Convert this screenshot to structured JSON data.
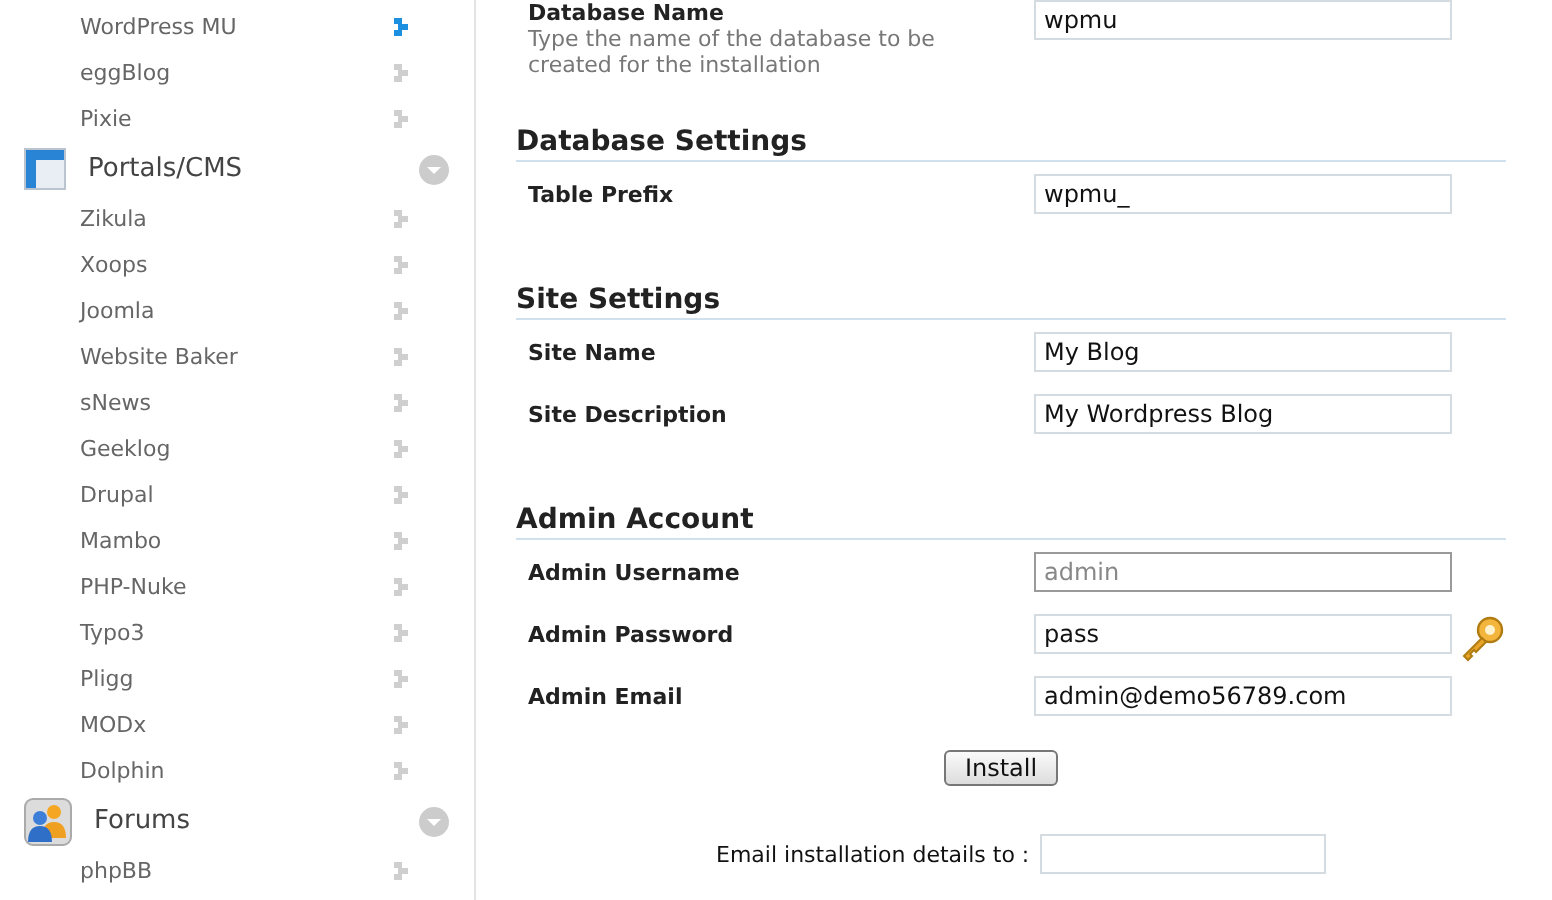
{
  "sidebar": {
    "groups": [
      {
        "items": [
          {
            "label": "WordPress MU",
            "selected": true
          },
          {
            "label": "eggBlog",
            "selected": false
          },
          {
            "label": "Pixie",
            "selected": false
          }
        ]
      },
      {
        "title": "Portals/CMS",
        "kind": "window",
        "expanded": true,
        "items": [
          {
            "label": "Zikula",
            "selected": false
          },
          {
            "label": "Xoops",
            "selected": false
          },
          {
            "label": "Joomla",
            "selected": false
          },
          {
            "label": "Website Baker",
            "selected": false
          },
          {
            "label": "sNews",
            "selected": false
          },
          {
            "label": "Geeklog",
            "selected": false
          },
          {
            "label": "Drupal",
            "selected": false
          },
          {
            "label": "Mambo",
            "selected": false
          },
          {
            "label": "PHP-Nuke",
            "selected": false
          },
          {
            "label": "Typo3",
            "selected": false
          },
          {
            "label": "Pligg",
            "selected": false
          },
          {
            "label": "MODx",
            "selected": false
          },
          {
            "label": "Dolphin",
            "selected": false
          }
        ]
      },
      {
        "title": "Forums",
        "kind": "people",
        "expanded": true,
        "items": [
          {
            "label": "phpBB",
            "selected": false
          }
        ]
      }
    ]
  },
  "form": {
    "sections": [
      {
        "fields": [
          {
            "label": "Database Name",
            "description": "Type the name of the database to be created for the installation",
            "value": "wpmu",
            "kind": "text"
          }
        ]
      },
      {
        "heading": "Database Settings",
        "fields": [
          {
            "label": "Table Prefix",
            "value": "wpmu_",
            "kind": "text"
          }
        ]
      },
      {
        "heading": "Site Settings",
        "fields": [
          {
            "label": "Site Name",
            "value": "My Blog",
            "kind": "text"
          },
          {
            "label": "Site Description",
            "value": "My Wordpress Blog",
            "kind": "text"
          }
        ]
      },
      {
        "heading": "Admin Account",
        "fields": [
          {
            "label": "Admin Username",
            "placeholder": "admin",
            "kind": "text"
          },
          {
            "label": "Admin Password",
            "value": "pass",
            "kind": "password"
          },
          {
            "label": "Admin Email",
            "value": "admin@demo56789.com",
            "kind": "text"
          }
        ]
      }
    ],
    "install_button": "Install",
    "email_details": {
      "label": "Email installation details to :"
    }
  }
}
